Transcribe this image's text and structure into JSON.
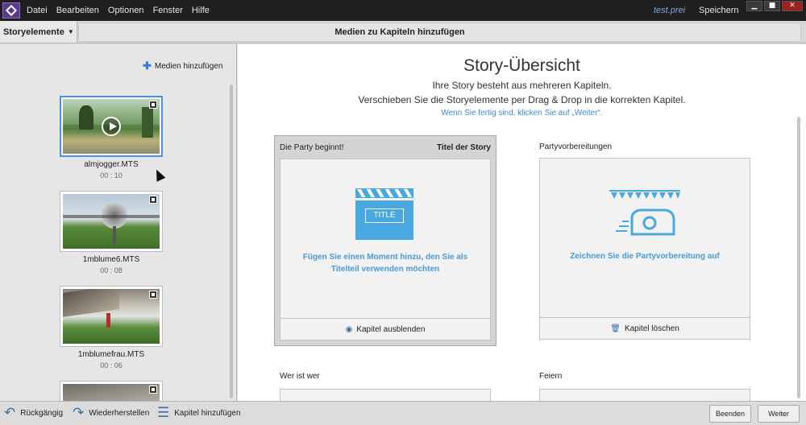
{
  "menubar": {
    "logo_icon": "premiere-elements-logo-icon",
    "items": [
      "Datei",
      "Bearbeiten",
      "Optionen",
      "Fenster",
      "Hilfe"
    ],
    "file_name": "test.prei",
    "save_label": "Speichern",
    "window_buttons": [
      "▁",
      "■",
      "✕"
    ]
  },
  "header": {
    "dropdown_label": "Storyelemente",
    "title": "Medien zu Kapiteln hinzufügen"
  },
  "sidebar": {
    "add_media_label": "Medien hinzufügen",
    "media": [
      {
        "name": "almjogger.MTS",
        "duration": "00 : 10",
        "selected": true
      },
      {
        "name": "1mblume6.MTS",
        "duration": "00 : 08",
        "selected": false
      },
      {
        "name": "1mblumefrau.MTS",
        "duration": "00 : 06",
        "selected": false
      },
      {
        "name": "",
        "duration": "",
        "selected": false
      }
    ]
  },
  "main": {
    "title": "Story-Übersicht",
    "subtitle_1": "Ihre Story besteht aus mehreren Kapiteln.",
    "subtitle_2": "Verschieben Sie die Storyelemente per Drag & Drop in die korrekten Kapitel.",
    "subtitle_3": "Wenn Sie fertig sind, klicken Sie auf „Weiter“.",
    "chapters": [
      {
        "name": "Die Party beginnt!",
        "tag": "Titel der Story",
        "clapper_label": "TITLE",
        "hint": "Fügen Sie einen Moment hinzu, den Sie als Titelteil verwenden möchten",
        "action": "Kapitel ausblenden",
        "action_icon": "eye-icon"
      },
      {
        "name": "Partyvorbereitungen",
        "tag": "",
        "hint": "Zeichnen Sie die Partyvorbereitung auf",
        "action": "Kapitel löschen",
        "action_icon": "trash-icon"
      },
      {
        "name": "Wer ist wer"
      },
      {
        "name": "Feiern"
      }
    ]
  },
  "bottombar": {
    "undo_label": "Rückgängig",
    "redo_label": "Wiederherstellen",
    "add_chapter_label": "Kapitel hinzufügen",
    "finish_label": "Beenden",
    "next_label": "Weiter"
  },
  "colors": {
    "accent": "#4aa8e0",
    "link": "#3a8ddb",
    "menubar": "#1f1f1f"
  }
}
